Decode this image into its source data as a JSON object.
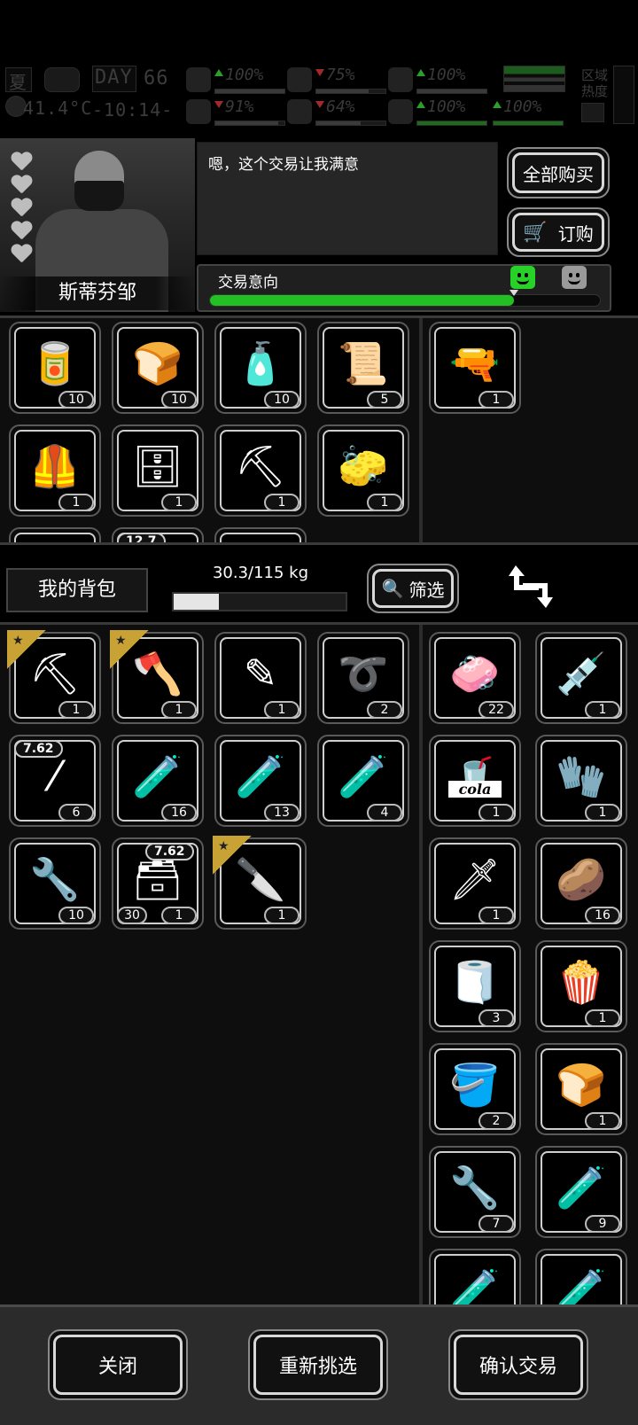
{
  "hud": {
    "season": "夏",
    "day_label": "DAY",
    "day": "66",
    "temperature": "41.4°C",
    "time": "-10:14-",
    "stats": [
      {
        "name": "health",
        "icon": "medkit-icon",
        "trend": "up",
        "value": "100%",
        "level": 100
      },
      {
        "name": "hunger",
        "icon": "stomach-icon",
        "trend": "down",
        "value": "75%",
        "level": 75
      },
      {
        "name": "stamina",
        "icon": "pill-icon",
        "trend": "up",
        "value": "100%",
        "level": 100
      },
      {
        "name": "mental",
        "icon": "brain-icon",
        "trend": "down",
        "value": "91%",
        "level": 91
      },
      {
        "name": "thirst",
        "icon": "water-drop-icon",
        "trend": "down",
        "value": "64%",
        "level": 64
      },
      {
        "name": "mood",
        "icon": "heart-icon",
        "trend": "up",
        "value": "100%",
        "level": 100
      },
      {
        "name": "energy",
        "icon": "energy-icon",
        "trend": "up",
        "value": "100%",
        "level": 100
      }
    ],
    "zone_heat_label": "区域热度"
  },
  "trader": {
    "name": "斯蒂芬邹",
    "hearts": 5,
    "dialog": "嗯，这个交易让我满意",
    "intent_label": "交易意向",
    "intent_level": 0.78,
    "buy_all_label": "全部购买",
    "order_label": "订购"
  },
  "trader_stock": [
    {
      "item": "canned-food",
      "count": "10"
    },
    {
      "item": "bread-loaf",
      "count": "10"
    },
    {
      "item": "bottles",
      "count": "10"
    },
    {
      "item": "bandage-rolls",
      "count": "5"
    },
    {
      "item": "tactical-vest",
      "count": "1"
    },
    {
      "item": "crate-drawer",
      "count": "1"
    },
    {
      "item": "shovel-blade",
      "count": "1"
    },
    {
      "item": "cloth-patch",
      "count": "1"
    },
    {
      "item": "partial-item-1",
      "count": ""
    },
    {
      "item": "partial-ammo",
      "count": "",
      "caliber": "12.7"
    },
    {
      "item": "partial-item-3",
      "count": ""
    }
  ],
  "trader_offer": [
    {
      "item": "flare-gun",
      "count": "1"
    }
  ],
  "backpack": {
    "title": "我的背包",
    "weight": "30.3/115 kg",
    "weight_ratio": 0.263,
    "filter_label": "筛选"
  },
  "my_items": [
    {
      "item": "shovel",
      "count": "1",
      "starred": true
    },
    {
      "item": "axe",
      "count": "1",
      "starred": true
    },
    {
      "item": "lockpicks",
      "count": "1"
    },
    {
      "item": "rope",
      "count": "2"
    },
    {
      "item": "rifle-round",
      "count": "6",
      "caliber": "7.62"
    },
    {
      "item": "test-tube-ii",
      "count": "16"
    },
    {
      "item": "test-tube-i",
      "count": "13"
    },
    {
      "item": "test-tube-iii",
      "count": "4"
    },
    {
      "item": "chisel-tool",
      "count": "10"
    },
    {
      "item": "magazine",
      "count": "1",
      "caliber": "7.62",
      "ammo": "30"
    },
    {
      "item": "caliper-knife",
      "count": "1",
      "starred": true
    }
  ],
  "offered_items": [
    {
      "item": "soap-bar",
      "count": "22"
    },
    {
      "item": "syringe",
      "count": "1"
    },
    {
      "item": "cola-cup",
      "count": "1",
      "text": "cola"
    },
    {
      "item": "gloves",
      "count": "1"
    },
    {
      "item": "machete",
      "count": "1"
    },
    {
      "item": "potato",
      "count": "16"
    },
    {
      "item": "cloth-rags",
      "count": "3"
    },
    {
      "item": "popcorn",
      "count": "1"
    },
    {
      "item": "ice-bucket",
      "count": "2"
    },
    {
      "item": "bread-loaf",
      "count": "1"
    },
    {
      "item": "chisel-tool",
      "count": "7"
    },
    {
      "item": "test-tube-ii",
      "count": "9"
    },
    {
      "item": "test-tube-i",
      "count": ""
    },
    {
      "item": "test-tube-iii",
      "count": ""
    }
  ],
  "footer": {
    "close_label": "关闭",
    "reselect_label": "重新挑选",
    "confirm_label": "确认交易"
  }
}
